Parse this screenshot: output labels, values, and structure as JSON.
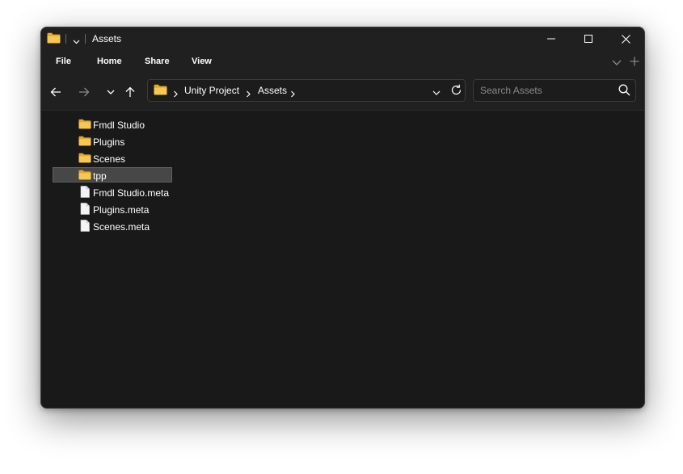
{
  "window": {
    "title": "Assets"
  },
  "menu": {
    "items": [
      {
        "label": "File"
      },
      {
        "label": "Home"
      },
      {
        "label": "Share"
      },
      {
        "label": "View"
      }
    ]
  },
  "address": {
    "breadcrumbs": [
      {
        "label": "Unity Project"
      },
      {
        "label": "Assets"
      }
    ]
  },
  "search": {
    "placeholder": "Search Assets"
  },
  "files": [
    {
      "name": "Fmdl Studio",
      "type": "folder",
      "selected": false
    },
    {
      "name": "Plugins",
      "type": "folder",
      "selected": false
    },
    {
      "name": "Scenes",
      "type": "folder",
      "selected": false
    },
    {
      "name": "tpp",
      "type": "folder",
      "selected": true
    },
    {
      "name": "Fmdl Studio.meta",
      "type": "file",
      "selected": false
    },
    {
      "name": "Plugins.meta",
      "type": "file",
      "selected": false
    },
    {
      "name": "Scenes.meta",
      "type": "file",
      "selected": false
    }
  ],
  "colors": {
    "window_bg": "#191919",
    "chrome_bg": "#202020",
    "selection": "#474747",
    "folder": "#F8C74F"
  }
}
